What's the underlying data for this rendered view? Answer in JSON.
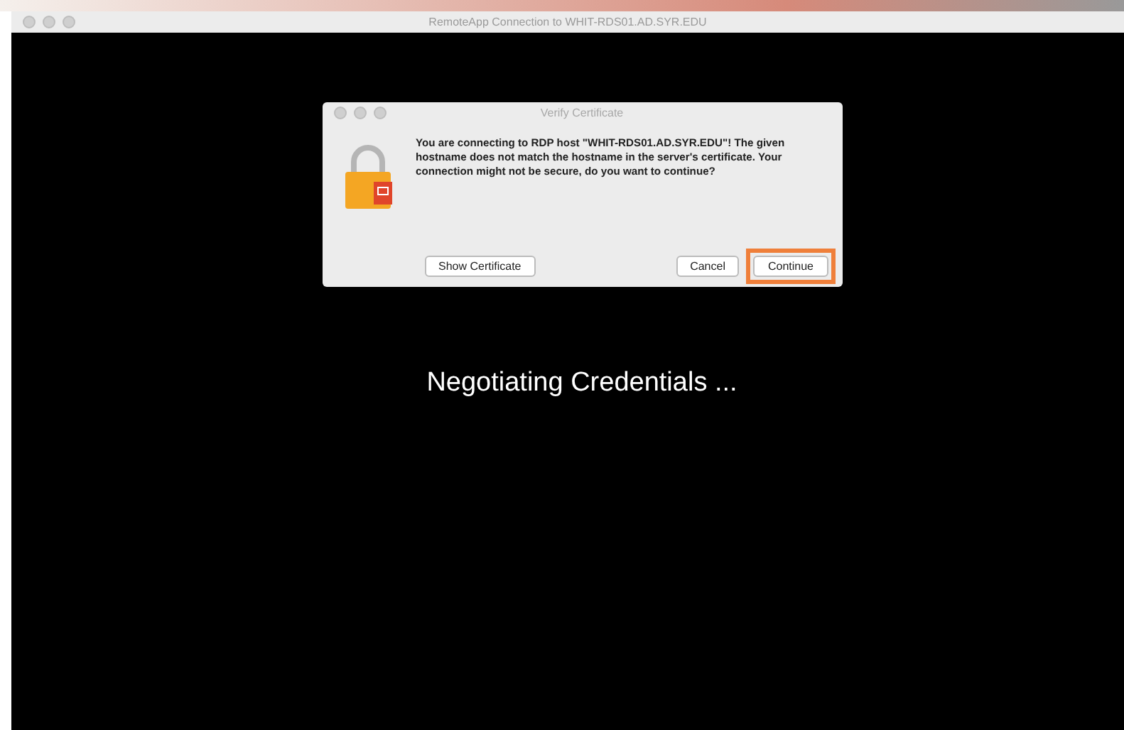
{
  "window": {
    "title": "RemoteApp Connection to WHIT-RDS01.AD.SYR.EDU"
  },
  "dialog": {
    "title": "Verify Certificate",
    "message": "You are connecting to RDP host \"WHIT-RDS01.AD.SYR.EDU\"! The given hostname does not match the hostname in the server's certificate. Your connection might not be secure, do you want to continue?",
    "buttons": [
      {
        "label": "Show Certificate",
        "kind": "left",
        "highlighted": false
      },
      {
        "label": "Cancel",
        "kind": "right",
        "highlighted": false
      },
      {
        "label": "Continue",
        "kind": "right",
        "highlighted": true
      }
    ]
  },
  "status": "Negotiating Credentials ..."
}
